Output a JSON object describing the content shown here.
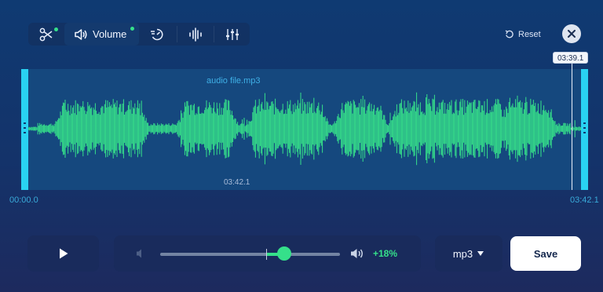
{
  "toolbar": {
    "tools": [
      {
        "id": "trim",
        "icon": "scissors-icon",
        "has_indicator": true
      },
      {
        "id": "volume",
        "icon": "speaker-icon",
        "label": "Volume",
        "has_indicator": true,
        "active": true
      },
      {
        "id": "speed",
        "icon": "speed-icon"
      },
      {
        "id": "equalizer-bars",
        "icon": "waveform-bars-icon"
      },
      {
        "id": "equalizer",
        "icon": "sliders-icon"
      }
    ],
    "volume_label": "Volume"
  },
  "header": {
    "reset_label": "Reset",
    "reset_icon": "reset-icon",
    "close_icon": "close-icon"
  },
  "track": {
    "file_name": "audio file.mp3",
    "selection_duration": "03:42.1",
    "start_time": "00:00.0",
    "end_time": "03:42.1",
    "playhead_time": "03:39.1",
    "playhead_fraction": 0.986
  },
  "controls": {
    "play_icon": "play-icon",
    "volume": {
      "low_icon": "volume-low-icon",
      "high_icon": "volume-high-icon",
      "value_label": "+18%",
      "fraction": 0.69,
      "center_fraction": 0.59
    },
    "format": {
      "selected": "mp3"
    },
    "save_label": "Save"
  },
  "colors": {
    "accent_green": "#35e08a",
    "handle_cyan": "#29d2f2",
    "waveform_bg": "#15487e"
  }
}
